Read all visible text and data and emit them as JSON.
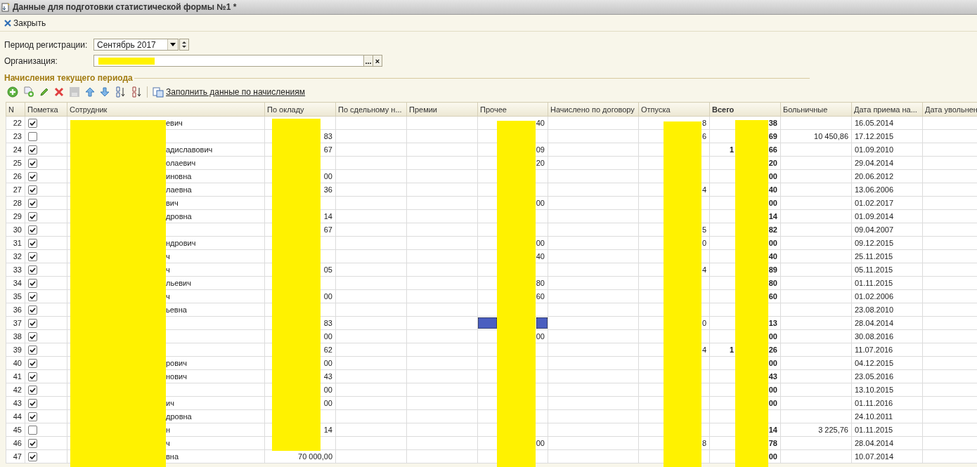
{
  "window": {
    "title": "Данные для подготовки статистической формы №1 *"
  },
  "command_bar": {
    "close_label": "Закрыть"
  },
  "form": {
    "period_label": "Период регистрации:",
    "period_value": "Сентябрь 2017",
    "organization_label": "Организация:",
    "organization_browse": "...",
    "organization_clear": "×"
  },
  "section": {
    "title": "Начисления текущего периода"
  },
  "table_toolbar": {
    "fill_link": "Заполнить данные по начислениям"
  },
  "table": {
    "columns": [
      {
        "label": "N",
        "kind": "index"
      },
      {
        "label": "Пометка",
        "kind": "check"
      },
      {
        "label": "Сотрудник",
        "kind": "employee"
      },
      {
        "label": "По окладу",
        "kind": "by_salary"
      },
      {
        "label": "По сдельному н...",
        "kind": "piecework"
      },
      {
        "label": "Премии",
        "kind": "bonuses"
      },
      {
        "label": "Прочее",
        "kind": "other"
      },
      {
        "label": "Начислено по договору",
        "kind": "contract"
      },
      {
        "label": "Отпуска",
        "kind": "vacation"
      },
      {
        "label": "Всего",
        "kind": "total"
      },
      {
        "label": "Больничные",
        "kind": "sick_leave"
      },
      {
        "label": "Дата приема на...",
        "kind": "hire_date"
      },
      {
        "label": "Дата увольнен",
        "kind": "dismissal_date"
      }
    ],
    "rows": [
      {
        "index": "22",
        "checked": true,
        "selected": false,
        "employee": "евич",
        "other": "40",
        "vacation": "8",
        "total": "38",
        "hire_date": "16.05.2014"
      },
      {
        "index": "23",
        "checked": false,
        "selected": false,
        "by_salary": "83",
        "vacation": "6",
        "total": "69",
        "sick_leave": "10 450,86",
        "hire_date": "17.12.2015"
      },
      {
        "index": "24",
        "checked": true,
        "selected": false,
        "employee": "адиславович",
        "by_salary": "67",
        "other": "09",
        "total_lead": "1",
        "total": "66",
        "hire_date": "01.09.2010"
      },
      {
        "index": "25",
        "checked": true,
        "selected": false,
        "employee": "олаевич",
        "other": "20",
        "total": "20",
        "hire_date": "29.04.2014"
      },
      {
        "index": "26",
        "checked": true,
        "selected": false,
        "employee": "иновна",
        "by_salary": "00",
        "total": "00",
        "hire_date": "20.06.2012"
      },
      {
        "index": "27",
        "checked": true,
        "selected": false,
        "employee": "лаевна",
        "by_salary": "36",
        "vacation": "4",
        "total": "40",
        "hire_date": "13.06.2006"
      },
      {
        "index": "28",
        "checked": true,
        "selected": false,
        "employee": "вич",
        "other": "00",
        "total": "00",
        "hire_date": "01.02.2017"
      },
      {
        "index": "29",
        "checked": true,
        "selected": false,
        "employee": "дровна",
        "by_salary": "14",
        "total": "14",
        "hire_date": "01.09.2014"
      },
      {
        "index": "30",
        "checked": true,
        "selected": false,
        "by_salary": "67",
        "vacation": "5",
        "total": "82",
        "hire_date": "09.04.2007"
      },
      {
        "index": "31",
        "checked": true,
        "selected": false,
        "employee": "ндрович",
        "other": "00",
        "vacation": "0",
        "total": "00",
        "hire_date": "09.12.2015"
      },
      {
        "index": "32",
        "checked": true,
        "selected": false,
        "employee": "ч",
        "other": "40",
        "total": "40",
        "hire_date": "25.11.2015"
      },
      {
        "index": "33",
        "checked": true,
        "selected": false,
        "employee": "ч",
        "by_salary": "05",
        "vacation": "4",
        "total": "89",
        "hire_date": "05.11.2015"
      },
      {
        "index": "34",
        "checked": true,
        "selected": false,
        "employee": "льевич",
        "other": "80",
        "total": "80",
        "hire_date": "01.11.2015"
      },
      {
        "index": "35",
        "checked": true,
        "selected": false,
        "employee": "ч",
        "by_salary": "00",
        "other": "60",
        "total": "60",
        "hire_date": "01.02.2006"
      },
      {
        "index": "36",
        "checked": true,
        "selected": false,
        "employee": "ьевна",
        "hire_date": "23.08.2010"
      },
      {
        "index": "37",
        "checked": true,
        "selected": true,
        "by_salary": "83",
        "vacation": "0",
        "total": "13",
        "hire_date": "28.04.2014"
      },
      {
        "index": "38",
        "checked": true,
        "selected": false,
        "by_salary": "00",
        "other": "00",
        "total": "00",
        "hire_date": "30.08.2016"
      },
      {
        "index": "39",
        "checked": true,
        "selected": false,
        "by_salary": "62",
        "vacation": "4",
        "total_lead": "1",
        "total": "26",
        "hire_date": "11.07.2016"
      },
      {
        "index": "40",
        "checked": true,
        "selected": false,
        "employee": "рович",
        "by_salary": "00",
        "total": "00",
        "hire_date": "04.12.2015"
      },
      {
        "index": "41",
        "checked": true,
        "selected": false,
        "employee": "нович",
        "by_salary": "43",
        "total": "43",
        "hire_date": "23.05.2016"
      },
      {
        "index": "42",
        "checked": true,
        "selected": false,
        "by_salary": "00",
        "total": "00",
        "hire_date": "13.10.2015"
      },
      {
        "index": "43",
        "checked": true,
        "selected": false,
        "employee": "ич",
        "by_salary": "00",
        "total": "00",
        "hire_date": "01.11.2016"
      },
      {
        "index": "44",
        "checked": true,
        "selected": false,
        "employee": "дровна",
        "hire_date": "24.10.2011"
      },
      {
        "index": "45",
        "checked": false,
        "selected": false,
        "employee": "н",
        "by_salary": "14",
        "total": "14",
        "sick_leave": "3 225,76",
        "hire_date": "01.11.2015"
      },
      {
        "index": "46",
        "checked": true,
        "selected": false,
        "employee": "ч",
        "other": "00",
        "vacation": "8",
        "total": "78",
        "hire_date": "28.04.2014"
      },
      {
        "index": "47",
        "checked": true,
        "selected": false,
        "employee": "вна",
        "by_salary": "70 000,00",
        "total": "00",
        "hire_date": "10.07.2014"
      }
    ]
  }
}
